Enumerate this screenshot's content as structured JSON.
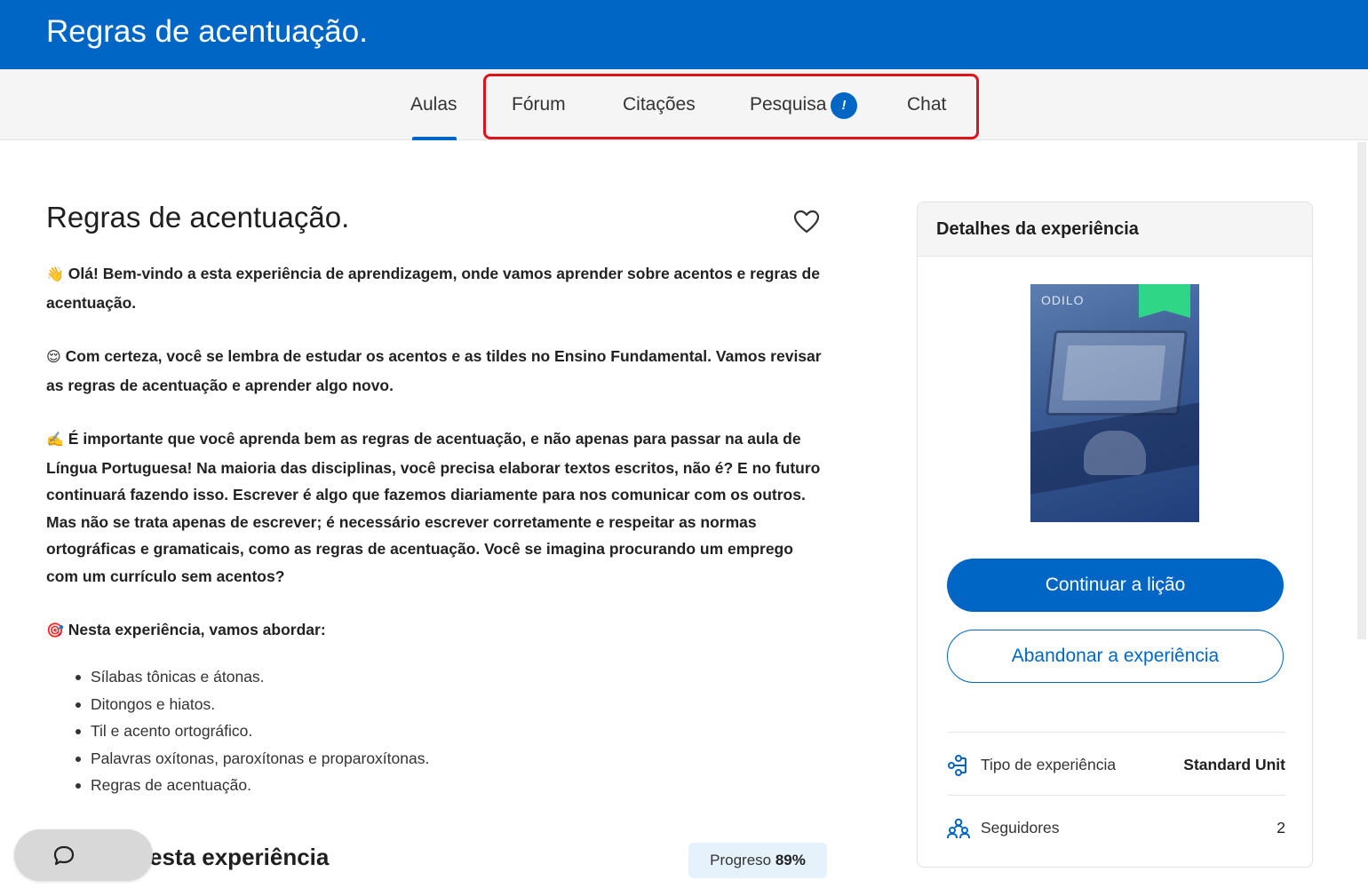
{
  "header": {
    "title": "Regras de acentuação."
  },
  "tabs": [
    {
      "label": "Aulas",
      "active": true
    },
    {
      "label": "Fórum"
    },
    {
      "label": "Citações"
    },
    {
      "label": "Pesquisa",
      "badge": "!"
    },
    {
      "label": "Chat"
    }
  ],
  "main": {
    "title": "Regras de acentuação.",
    "paragraphs": [
      {
        "emoji": "👋",
        "text": "Olá! Bem-vindo a esta experiência de aprendizagem, onde vamos aprender sobre acentos e regras de acentuação."
      },
      {
        "emoji": "😌",
        "text": "Com certeza, você se lembra de estudar os acentos e as tildes no Ensino Fundamental. Vamos revisar as regras de acentuação e aprender algo novo."
      },
      {
        "emoji": "✍️",
        "text": "É importante que você aprenda bem as regras de acentuação, e não apenas para passar na aula de Língua Portuguesa! Na maioria das disciplinas, você precisa elaborar textos escritos, não é? E no futuro continuará fazendo isso. Escrever é algo que fazemos diariamente para nos comunicar com os outros. Mas não se trata apenas de escrever; é necessário escrever corretamente e respeitar as normas ortográficas e gramaticais, como as regras de acentuação. Você se imagina procurando um emprego com um currículo sem acentos?"
      },
      {
        "emoji": "🎯",
        "text": "Nesta experiência, vamos abordar:"
      }
    ],
    "topics": [
      "Sílabas tônicas e átonas.",
      "Ditongos e hiatos.",
      "Til e acento ortográfico.",
      "Palavras oxítonas, paroxítonas e proparoxítonas.",
      "Regras de acentuação."
    ],
    "section_title": "esta experiência",
    "progress_label": "Progreso",
    "progress_value": "89%"
  },
  "details": {
    "header": "Detalhes da experiência",
    "cover_brand": "ODILO",
    "continue_label": "Continuar a lição",
    "abandon_label": "Abandonar a experiência",
    "type_label": "Tipo de experiência",
    "type_value": "Standard Unit",
    "followers_label": "Seguidores",
    "followers_value": "2"
  },
  "colors": {
    "brand": "#0066c6",
    "highlight": "#e0131a"
  },
  "icons": {
    "favorite": "heart-icon",
    "chat": "chat-bubble-icon",
    "type": "hierarchy-icon",
    "followers": "users-icon"
  }
}
